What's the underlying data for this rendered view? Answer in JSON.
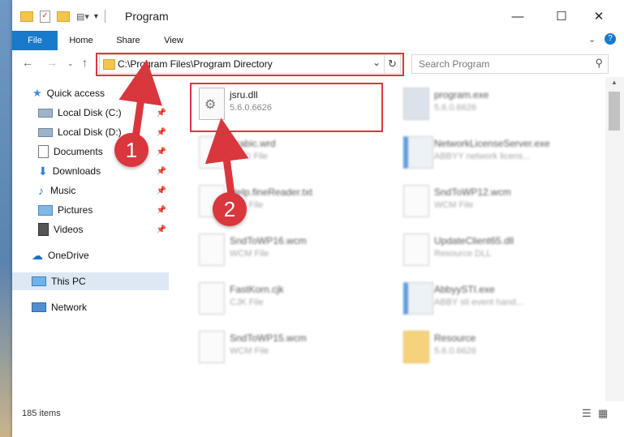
{
  "window": {
    "title": "Program"
  },
  "ribbon": {
    "tabs": [
      "File",
      "Home",
      "Share",
      "View"
    ]
  },
  "address": {
    "path": "C:\\Program Files\\Program Directory",
    "search_placeholder": "Search Program"
  },
  "nav": {
    "items": [
      {
        "label": "Quick access",
        "icon": "star-icon",
        "pinned": false
      },
      {
        "label": "Local Disk (C:)",
        "icon": "drive-icon",
        "pinned": true
      },
      {
        "label": "Local Disk (D:)",
        "icon": "drive-icon",
        "pinned": true
      },
      {
        "label": "Documents",
        "icon": "documents-icon",
        "pinned": true
      },
      {
        "label": "Downloads",
        "icon": "download-icon",
        "pinned": true
      },
      {
        "label": "Music",
        "icon": "music-icon",
        "pinned": true
      },
      {
        "label": "Pictures",
        "icon": "pictures-icon",
        "pinned": true
      },
      {
        "label": "Videos",
        "icon": "videos-icon",
        "pinned": true
      },
      {
        "label": "OneDrive",
        "icon": "cloud-icon",
        "pinned": false
      },
      {
        "label": "This PC",
        "icon": "pc-icon",
        "pinned": false
      },
      {
        "label": "Network",
        "icon": "network-icon",
        "pinned": false
      }
    ]
  },
  "files": [
    {
      "name": "jsru.dll",
      "sub": "5.6.0.6626",
      "highlight": true
    },
    {
      "name": "program.exe",
      "sub": "5.6.0.6626"
    },
    {
      "name": "Arabic.wrd",
      "sub": "WRD File"
    },
    {
      "name": "NetworkLicenseServer.exe",
      "sub": "ABBYY network licens..."
    },
    {
      "name": "Help.fineReader.txt",
      "sub": "TXT File"
    },
    {
      "name": "SndToWP12.wcm",
      "sub": "WCM File"
    },
    {
      "name": "SndToWP16.wcm",
      "sub": "WCM File"
    },
    {
      "name": "UpdateClient65.dll",
      "sub": "Resource DLL"
    },
    {
      "name": "FastKorn.cjk",
      "sub": "CJK File"
    },
    {
      "name": "AbbyySTI.exe",
      "sub": "ABBY sti event hand..."
    },
    {
      "name": "SndToWP15.wcm",
      "sub": "WCM File"
    },
    {
      "name": "Resource",
      "sub": "5.6.0.6626"
    }
  ],
  "status": {
    "count": "185 items"
  },
  "annotations": {
    "step1": "1",
    "step2": "2",
    "color": "#d9363e"
  }
}
